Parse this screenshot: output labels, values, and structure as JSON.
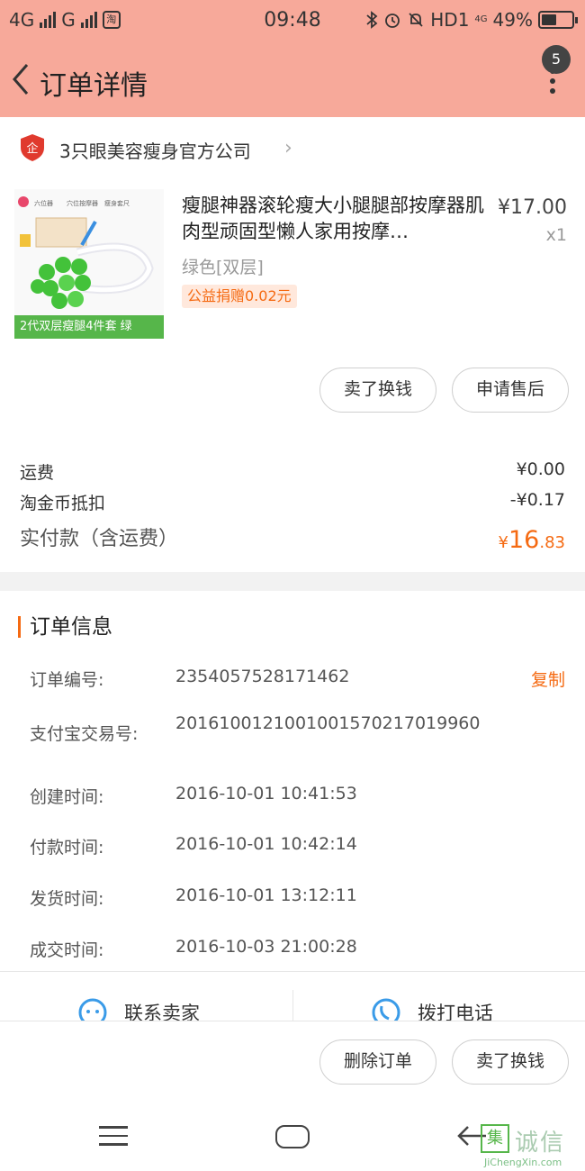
{
  "status_bar": {
    "network_1": "4G",
    "network_2": "G",
    "app_icon_label": "淘",
    "time": "09:48",
    "hd_label": "HD1",
    "signal_4g_small": "4G",
    "battery_percent": "49%",
    "battery_level": 0.49
  },
  "nav": {
    "title": "订单详情",
    "badge_count": "5"
  },
  "shop": {
    "logo_text": "企",
    "name": "3只眼美容瘦身官方公司"
  },
  "product": {
    "thumb_caption": "2代双层瘦腿4件套 绿",
    "thumb_tags": [
      "六位器",
      "穴位按摩器",
      "瘦身套尺"
    ],
    "title": "瘦腿神器滚轮瘦大小腿腿部按摩器肌肉型顽固型懒人家用按摩…",
    "price": "¥17.00",
    "quantity": "x1",
    "sku": "绿色[双层]",
    "charity": "公益捐赠0.02元"
  },
  "product_actions": {
    "sell_label": "卖了换钱",
    "aftersale_label": "申请售后"
  },
  "fees": {
    "freight_label": "运费",
    "freight_value": "¥0.00",
    "coin_label": "淘金币抵扣",
    "coin_value": "-¥0.17",
    "paid_label": "实付款（含运费）",
    "paid_currency": "¥",
    "paid_integer": "16",
    "paid_decimal": ".83"
  },
  "order_info": {
    "heading": "订单信息",
    "order_no_label": "订单编号:",
    "order_no_value": "2354057528171462",
    "copy_label": "复制",
    "alipay_label": "支付宝交易号:",
    "alipay_value": "2016100121001001570217019960",
    "created_label": "创建时间:",
    "created_value": "2016-10-01 10:41:53",
    "paid_label": "付款时间:",
    "paid_value": "2016-10-01 10:42:14",
    "shipped_label": "发货时间:",
    "shipped_value": "2016-10-01 13:12:11",
    "completed_label": "成交时间:",
    "completed_value": "2016-10-03 21:00:28"
  },
  "contact": {
    "seller_label": "联系卖家",
    "phone_label": "拨打电话"
  },
  "bottom_actions": {
    "delete_label": "删除订单",
    "sell_label": "卖了换钱"
  },
  "watermark": {
    "box_char": "集",
    "text": "诚信",
    "url": "JiChengXin.com"
  },
  "colors": {
    "header_bg": "#f7a99a",
    "accent": "#f56a12",
    "thumb_green": "#56b64a"
  }
}
